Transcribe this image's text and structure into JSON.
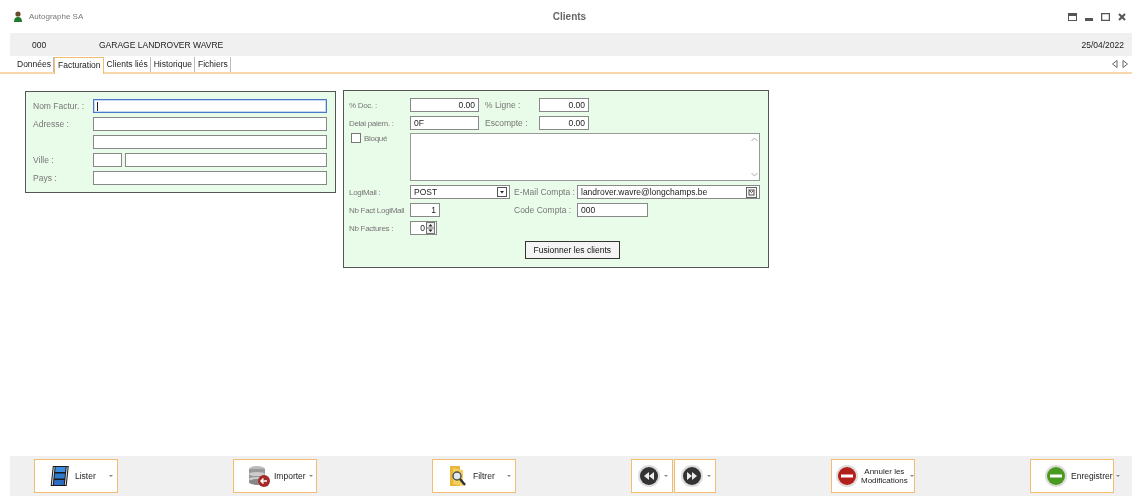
{
  "window": {
    "app_title": "Autographe SA",
    "title": "Clients"
  },
  "header": {
    "code": "000",
    "name": "GARAGE LANDROVER WAVRE",
    "date": "25/04/2022"
  },
  "tabs": [
    {
      "label": "Données",
      "selected": false
    },
    {
      "label": "Facturation",
      "selected": true
    },
    {
      "label": "Clients liés",
      "selected": false
    },
    {
      "label": "Historique",
      "selected": false
    },
    {
      "label": "Fichiers",
      "selected": false
    }
  ],
  "address_panel": {
    "rows": [
      {
        "label": "Nom Factur. :",
        "kind": "single",
        "focused": true
      },
      {
        "label": "Adresse :",
        "kind": "single",
        "focused": false
      },
      {
        "kind": "single",
        "focused": false
      },
      {
        "label": "Ville :",
        "kind": "split",
        "focused": false
      },
      {
        "label": "Pays :",
        "kind": "single",
        "focused": false
      }
    ]
  },
  "terms_panel": {
    "doc_percent": {
      "label": "% Doc. :",
      "value": "0.00"
    },
    "line_percent": {
      "label": "% Ligne :",
      "value": "0.00"
    },
    "payment_delay": {
      "label": "Delai paiem. :",
      "value": "0F"
    },
    "discount": {
      "label": "Escompte :",
      "value": "0.00"
    },
    "blocked": {
      "label": "Bloqué",
      "checked": false
    },
    "logimail": {
      "label": "LogiMail :",
      "value": "POST"
    },
    "email": {
      "label": "E-Mail Compta :",
      "value": "landrover.wavre@longchamps.be"
    },
    "invoices_per_logimail": {
      "label": "Nb Fact LogiMail",
      "value": "1"
    },
    "account_code": {
      "label": "Code Compta :",
      "value": "000"
    },
    "invoice_count": {
      "label": "Nb Factures :",
      "value": "0"
    },
    "merge_button": "Fusionner les clients"
  },
  "toolbar": [
    {
      "kind": "list",
      "label": "Lister"
    },
    {
      "kind": "import",
      "label": "Importer"
    },
    {
      "kind": "filter",
      "label": "Filtrer"
    },
    {
      "kind": "previous"
    },
    {
      "kind": "next"
    },
    {
      "kind": "cancel",
      "label": "Annuler les\nModifications"
    },
    {
      "kind": "save",
      "label": "Enregistrer"
    }
  ]
}
